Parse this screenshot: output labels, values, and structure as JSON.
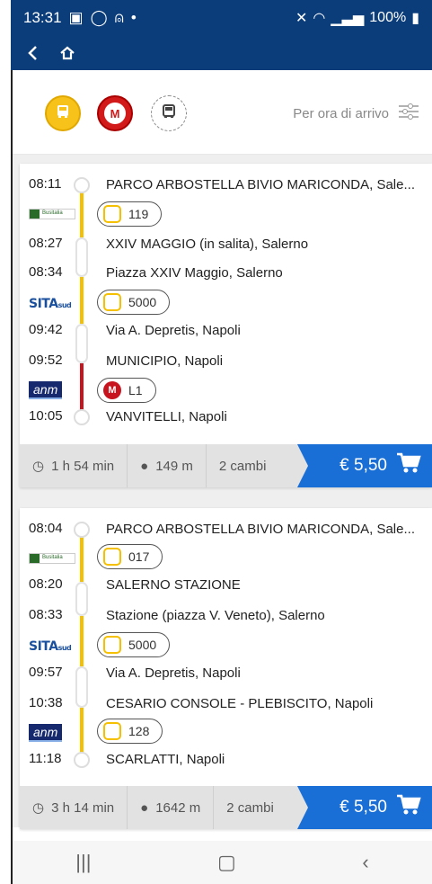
{
  "status": {
    "time": "13:31",
    "battery": "100%"
  },
  "filters": {
    "sort_label": "Per ora di arrivo"
  },
  "journeys": [
    {
      "stops": [
        {
          "time": "08:11",
          "name": "PARCO ARBOSTELLA BIVIO MARICONDA, Sale..."
        },
        {
          "time": "08:27",
          "name": "XXIV MAGGIO (in salita), Salerno"
        },
        {
          "time": "08:34",
          "name": "Piazza XXIV Maggio, Salerno"
        },
        {
          "time": "09:42",
          "name": "Via A. Depretis, Napoli"
        },
        {
          "time": "09:52",
          "name": "MUNICIPIO, Napoli"
        },
        {
          "time": "10:05",
          "name": "VANVITELLI, Napoli"
        }
      ],
      "lines": [
        "119",
        "5000",
        "L1"
      ],
      "operators": [
        "Busitalia",
        "SITA",
        "anm"
      ],
      "duration": "1 h 54 min",
      "walk": "149 m",
      "changes": "2 cambi",
      "price": "€ 5,50"
    },
    {
      "stops": [
        {
          "time": "08:04",
          "name": "PARCO ARBOSTELLA BIVIO MARICONDA, Sale..."
        },
        {
          "time": "08:20",
          "name": "SALERNO STAZIONE"
        },
        {
          "time": "08:33",
          "name": "Stazione (piazza V. Veneto), Salerno"
        },
        {
          "time": "09:57",
          "name": "Via A. Depretis, Napoli"
        },
        {
          "time": "10:38",
          "name": "CESARIO CONSOLE - PLEBISCITO, Napoli"
        },
        {
          "time": "11:18",
          "name": "SCARLATTI, Napoli"
        }
      ],
      "lines": [
        "017",
        "5000",
        "128"
      ],
      "operators": [
        "Busitalia",
        "SITA",
        "anm"
      ],
      "duration": "3 h 14 min",
      "walk": "1642 m",
      "changes": "2 cambi",
      "price": "€ 5,50"
    }
  ],
  "colors": {
    "header": "#0b3d7a",
    "bus": "#f4c000",
    "metro": "#c8141e",
    "price": "#1a6fd6"
  },
  "icons": [
    "back-icon",
    "home-icon",
    "bus-icon",
    "metro-icon",
    "coach-icon",
    "filter-icon",
    "clock-icon",
    "walk-icon",
    "cart-icon"
  ]
}
